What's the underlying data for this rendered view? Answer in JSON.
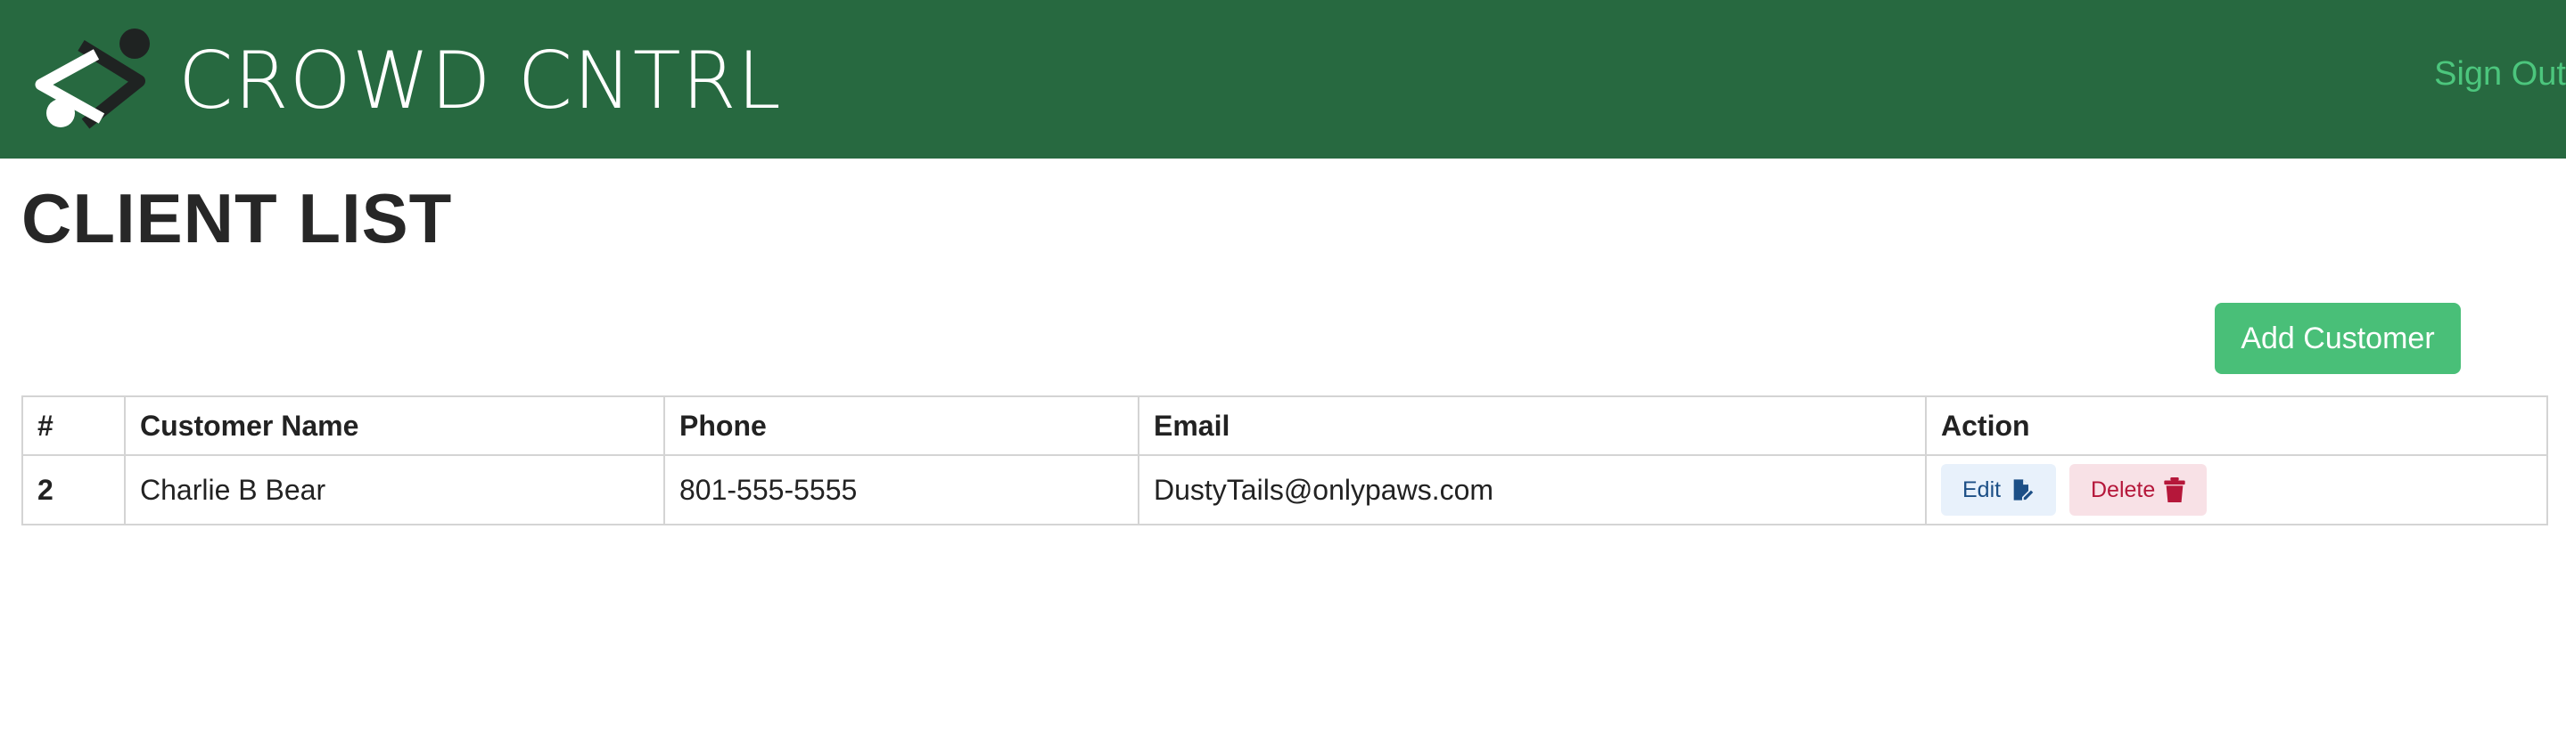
{
  "header": {
    "brand": "CROWD CNTRL",
    "sign_out": "Sign Out",
    "logo_icon": "crowd-cntrl-logo"
  },
  "page": {
    "title": "CLIENT LIST",
    "add_button": "Add Customer"
  },
  "table": {
    "columns": [
      "#",
      "Customer Name",
      "Phone",
      "Email",
      "Action"
    ],
    "rows": [
      {
        "num": "2",
        "name": "Charlie B Bear",
        "phone": "801-555-5555",
        "email": "DustyTails@onlypaws.com",
        "edit_label": "Edit",
        "edit_icon": "file-pen-icon",
        "delete_label": "Delete",
        "delete_icon": "trash-icon"
      }
    ]
  },
  "colors": {
    "navbar": "#276940",
    "sign_out": "#4cc67d",
    "add_button": "#49bf78",
    "edit_bg": "#e8f1fb",
    "edit_text": "#1c4f86",
    "delete_bg": "#f8e1e6",
    "delete_text": "#b5173a"
  }
}
